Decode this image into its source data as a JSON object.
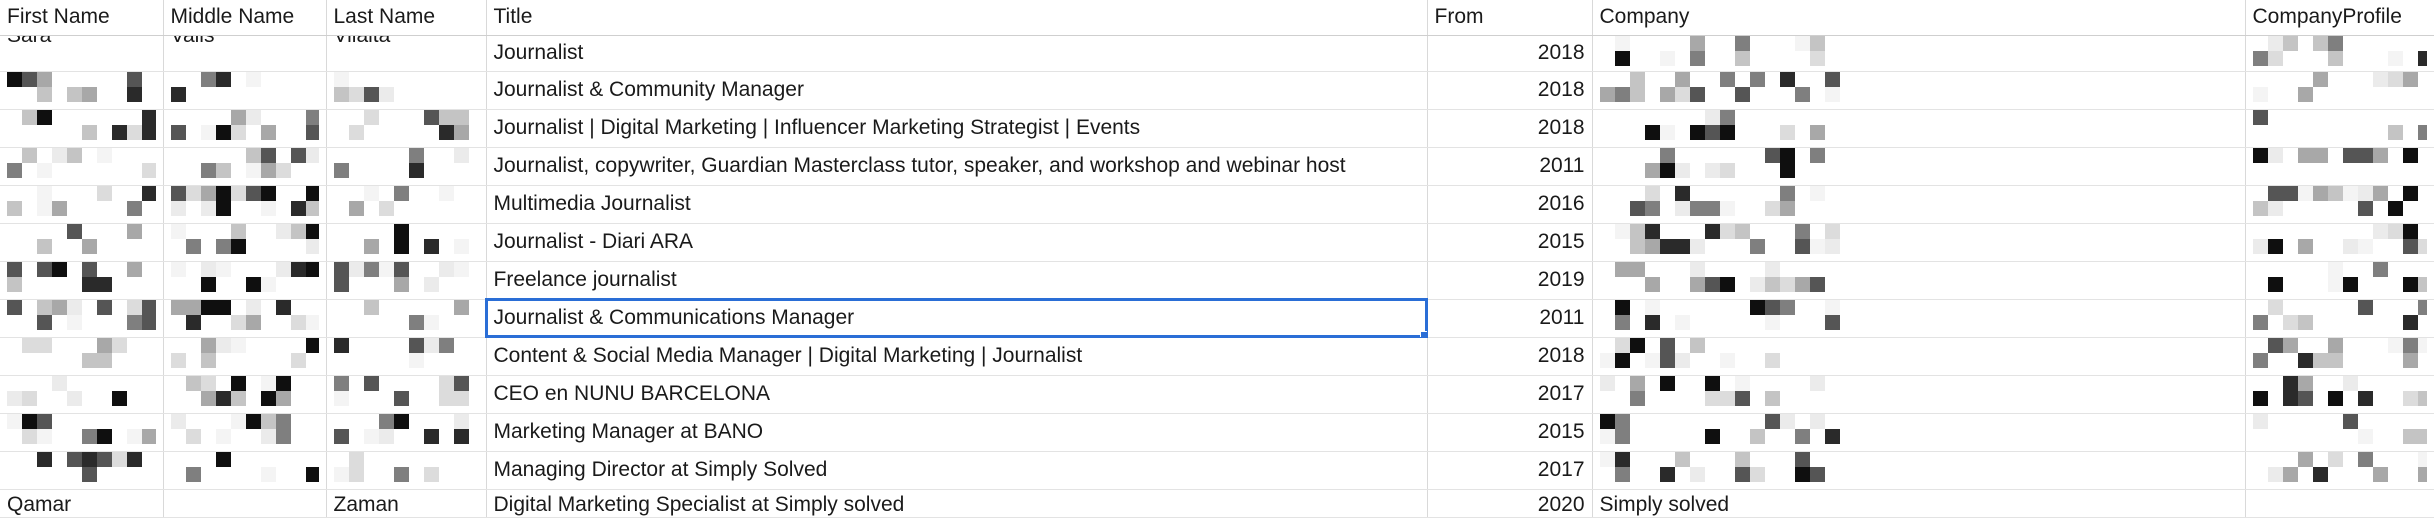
{
  "sheet": {
    "columns": [
      "First Name",
      "Middle Name",
      "Last Name",
      "Title",
      "From",
      "Company",
      "CompanyProfile"
    ],
    "top_partial": {
      "first": "Sara",
      "middle": "Valls",
      "last": "Vilalta"
    },
    "rows": [
      {
        "title": "Journalist",
        "from": "2018"
      },
      {
        "title": "Journalist & Community Manager",
        "from": "2018"
      },
      {
        "title": "Journalist | Digital Marketing | Influencer Marketing Strategist | Events",
        "from": "2018"
      },
      {
        "title": "Journalist, copywriter, Guardian Masterclass tutor, speaker, and workshop and webinar host",
        "from": "2011"
      },
      {
        "title": "Multimedia Journalist",
        "from": "2016"
      },
      {
        "title": "Journalist - Diari ARA",
        "from": "2015"
      },
      {
        "title": "Freelance journalist",
        "from": "2019"
      },
      {
        "title": "Journalist & Communications Manager",
        "from": "2011"
      },
      {
        "title": "Content & Social Media Manager | Digital Marketing | Journalist",
        "from": "2018"
      },
      {
        "title": "CEO en NUNU BARCELONA",
        "from": "2017"
      },
      {
        "title": "Marketing Manager at BANO",
        "from": "2015"
      },
      {
        "title": "Managing Director at Simply Solved",
        "from": "2017"
      }
    ],
    "last_row": {
      "first": "Qamar",
      "middle": "",
      "last": "Zaman",
      "title": "Digital Marketing Specialist at Simply solved",
      "from": "2020",
      "company": "Simply solved",
      "profile": ""
    },
    "selected_row_index": 7,
    "colors": {
      "selection": "#2a6ed6",
      "grid_line": "#d9d9d9"
    }
  }
}
